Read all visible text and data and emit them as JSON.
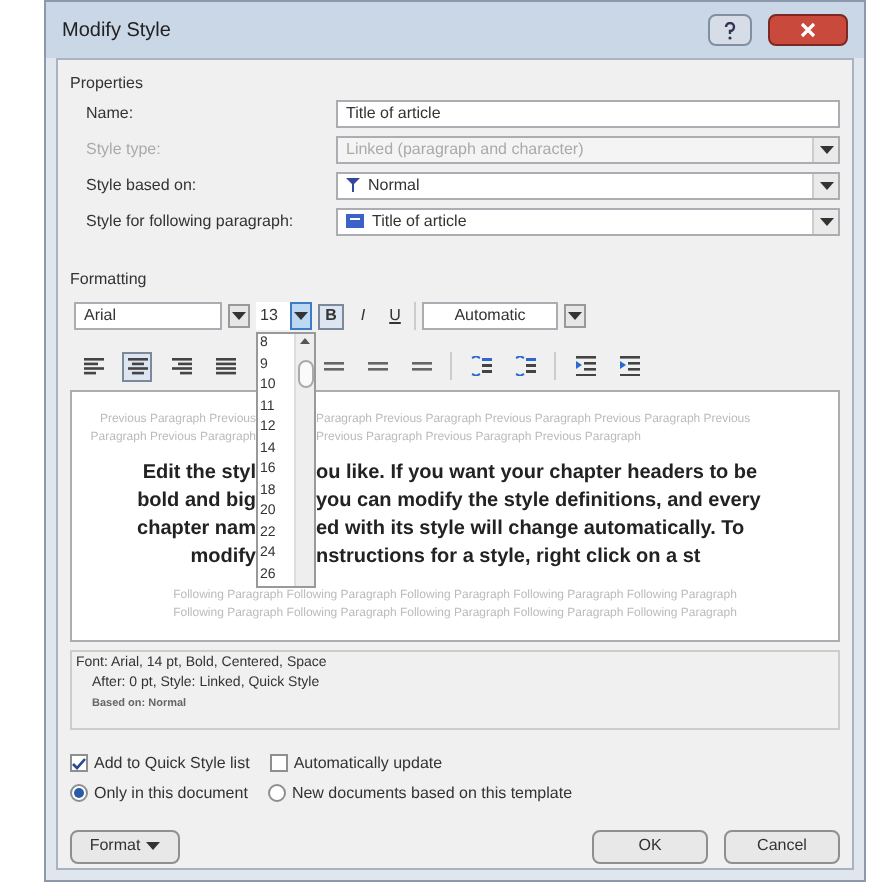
{
  "window": {
    "title": "Modify Style"
  },
  "properties": {
    "label": "Properties",
    "fields": [
      {
        "label": "Name:",
        "value": "Title of article",
        "kind": "text",
        "disabled": false
      },
      {
        "label": "Style type:",
        "value": "Linked (paragraph and character)",
        "kind": "select",
        "disabled": true
      },
      {
        "label": "Style based on:",
        "value": "Normal",
        "kind": "select",
        "disabled": false
      },
      {
        "label": "Style for following paragraph:",
        "value": "Title of article",
        "kind": "select",
        "disabled": false
      }
    ]
  },
  "formatting": {
    "label": "Formatting",
    "font": "Arial",
    "size": "13",
    "font_color_label": "Automatic",
    "styles": [
      {
        "label": "B",
        "kind": "bold",
        "selected": true
      },
      {
        "label": "I",
        "kind": "italic",
        "selected": false
      },
      {
        "label": "U",
        "kind": "underline",
        "selected": false
      }
    ],
    "size_list": [
      "8",
      "9",
      "10",
      "11",
      "12",
      "14",
      "16",
      "18",
      "20",
      "22",
      "24",
      "26"
    ],
    "align": [
      {
        "kind": "left",
        "selected": false
      },
      {
        "kind": "center",
        "selected": true
      },
      {
        "kind": "right",
        "selected": false
      },
      {
        "kind": "justify",
        "selected": false
      },
      {
        "kind": "spacing",
        "selected": false
      },
      {
        "kind": "spacing",
        "selected": false
      },
      {
        "kind": "spacing",
        "selected": false
      },
      {
        "kind": "para",
        "selected": false
      },
      {
        "kind": "para",
        "selected": false
      },
      {
        "kind": "indent",
        "selected": false
      },
      {
        "kind": "indent",
        "selected": false
      }
    ]
  },
  "preview": {
    "previous_lines": [
      {
        "left": "Previous Paragraph Previous",
        "right": "Paragraph Previous Paragraph Previous Paragraph Previous Paragraph Previous"
      },
      {
        "left": "Paragraph Previous Paragraph",
        "right": "Previous Paragraph Previous Paragraph Previous Paragraph"
      }
    ],
    "main_lines": [
      {
        "left": "Edit the styl",
        "right": "ou like. If you want your chapter headers to be"
      },
      {
        "left": "bold and big",
        "right": "you can modify the style definitions, and every"
      },
      {
        "left": "chapter nam",
        "right": "ed with its style will change automatically. To"
      },
      {
        "left": "modify",
        "right": "nstructions for a style, right click on a st"
      }
    ],
    "following_lines": [
      "Following Paragraph Following Paragraph Following Paragraph Following Paragraph Following Paragraph",
      "Following Paragraph Following Paragraph Following Paragraph Following Paragraph Following Paragraph"
    ]
  },
  "description": [
    "Font: Arial, 14 pt, Bold, Centered, Space",
    "After: 0 pt, Style: Linked, Quick Style",
    "Based on: Normal"
  ],
  "checkboxes": [
    {
      "label": "Add to Quick Style list",
      "checked": true
    },
    {
      "label": "Automatically update",
      "checked": false
    }
  ],
  "radios": [
    {
      "label": "Only in this document",
      "selected": true
    },
    {
      "label": "New documents based on this template",
      "selected": false
    }
  ],
  "buttons": {
    "format": "Format",
    "ok": "OK",
    "cancel": "Cancel"
  }
}
